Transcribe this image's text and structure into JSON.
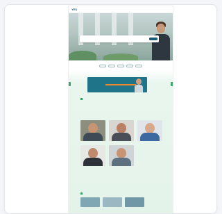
{
  "site": {
    "logo": "YES",
    "top_links": [
      "",
      "",
      ""
    ]
  },
  "search": {
    "fields": [
      "",
      "",
      ""
    ],
    "button": ""
  },
  "pills": [
    "",
    "",
    "",
    "",
    ""
  ],
  "banner": {
    "text": ""
  },
  "section": {
    "title": "",
    "subtitle": "",
    "note": ""
  },
  "people": [
    {
      "name": "",
      "role": ""
    },
    {
      "name": "",
      "role": ""
    },
    {
      "name": "",
      "role": ""
    },
    {
      "name": "",
      "role": ""
    },
    {
      "name": "",
      "role": ""
    }
  ],
  "bottom": {
    "title": "",
    "text": ""
  },
  "colors": {
    "brand": "#1d5a73",
    "accent_green": "#2e9e62",
    "accent_orange": "#f08a28",
    "mint_bg": "#e4f3ea"
  }
}
